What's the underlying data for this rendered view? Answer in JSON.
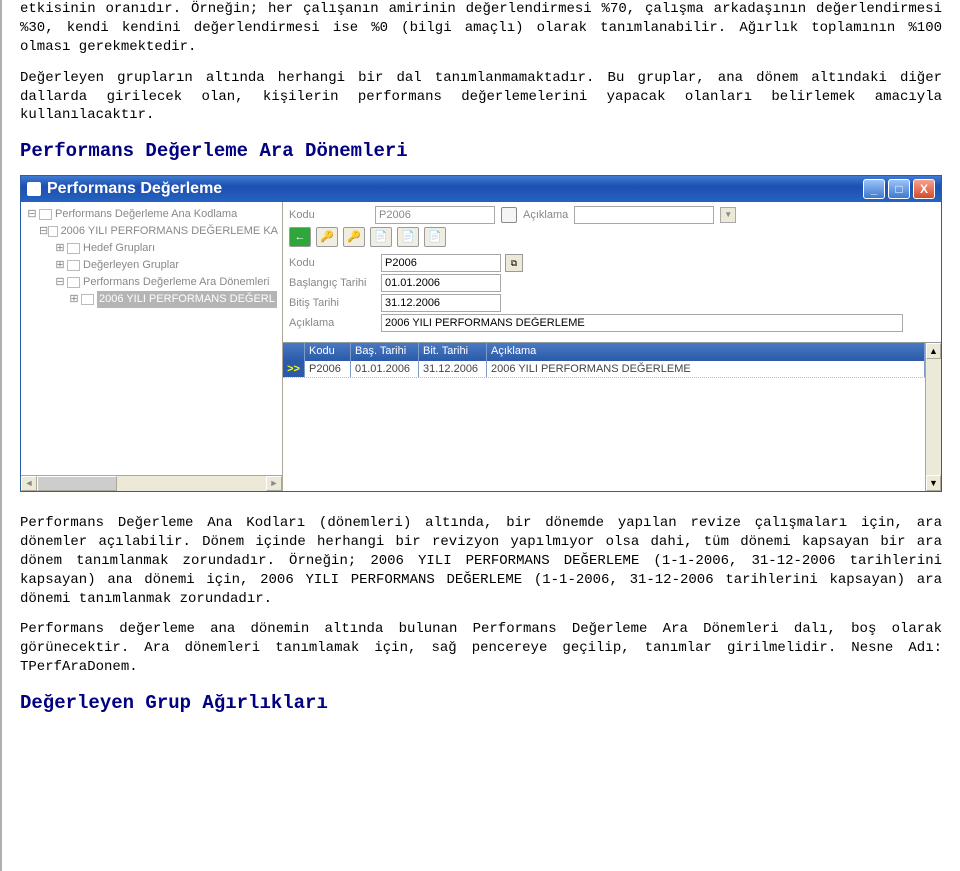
{
  "paragraphs": {
    "p1": "etkisinin oranıdır. Örneğin; her çalışanın amirinin değerlendirmesi %70, çalışma arkadaşının değerlendirmesi %30, kendi kendini değerlendirmesi ise %0 (bilgi amaçlı) olarak tanımlanabilir. Ağırlık toplamının %100 olması gerekmektedir.",
    "p2": "Değerleyen grupların altında herhangi bir dal tanımlanmamaktadır. Bu gruplar, ana dönem altındaki diğer dallarda girilecek olan, kişilerin performans değerlemelerini yapacak olanları belirlemek amacıyla kullanılacaktır.",
    "p3": "Performans Değerleme Ana Kodları (dönemleri) altında, bir dönemde yapılan revize çalışmaları için, ara dönemler açılabilir. Dönem içinde herhangi bir revizyon yapılmıyor olsa dahi, tüm dönemi kapsayan bir ara dönem tanımlanmak zorundadır. Örneğin; 2006 YILI PERFORMANS DEĞERLEME (1-1-2006, 31-12-2006 tarihlerini kapsayan) ana dönemi için, 2006 YILI PERFORMANS DEĞERLEME (1-1-2006, 31-12-2006 tarihlerini kapsayan) ara dönemi tanımlanmak zorundadır.",
    "p4": "Performans değerleme ana dönemin altında bulunan Performans Değerleme Ara Dönemleri dalı, boş olarak görünecektir. Ara dönemleri tanımlamak için, sağ pencereye geçilip, tanımlar girilmelidir. Nesne Adı: TPerfAraDonem."
  },
  "headings": {
    "h1": "Performans Değerleme Ara Dönemleri",
    "h2": "Değerleyen Grup Ağırlıkları"
  },
  "window": {
    "title": "Performans Değerleme",
    "buttons": {
      "min": "_",
      "max": "□",
      "close": "X"
    }
  },
  "tree": {
    "n0": "Performans Değerleme Ana Kodlama",
    "n1": "2006 YILI PERFORMANS DEĞERLEME KA",
    "n2": "Hedef Grupları",
    "n3": "Değerleyen Gruplar",
    "n4": "Performans Değerleme Ara Dönemleri",
    "n5": "2006 YILI PERFORMANS DEĞERL"
  },
  "filter": {
    "kodu_label": "Kodu",
    "kodu_value": "P2006",
    "acik_label": "Açıklama",
    "acik_value": ""
  },
  "form": {
    "kodu_label": "Kodu",
    "kodu_value": "P2006",
    "bas_label": "Başlangıç Tarihi",
    "bas_value": "01.01.2006",
    "bit_label": "Bitiş Tarihi",
    "bit_value": "31.12.2006",
    "acik_label": "Açıklama",
    "acik_value": "2006 YILI PERFORMANS DEĞERLEME"
  },
  "grid": {
    "headers": {
      "kodu": "Kodu",
      "bas": "Baş. Tarihi",
      "bit": "Bit. Tarihi",
      "acik": "Açıklama"
    },
    "row_marker": ">>",
    "rows": [
      {
        "kodu": "P2006",
        "bas": "01.01.2006",
        "bit": "31.12.2006",
        "acik": "2006 YILI PERFORMANS DEĞERLEME"
      }
    ]
  },
  "glyphs": {
    "left": "◄",
    "right": "►",
    "up": "▲",
    "down": "▼",
    "dropdown": "▼"
  }
}
